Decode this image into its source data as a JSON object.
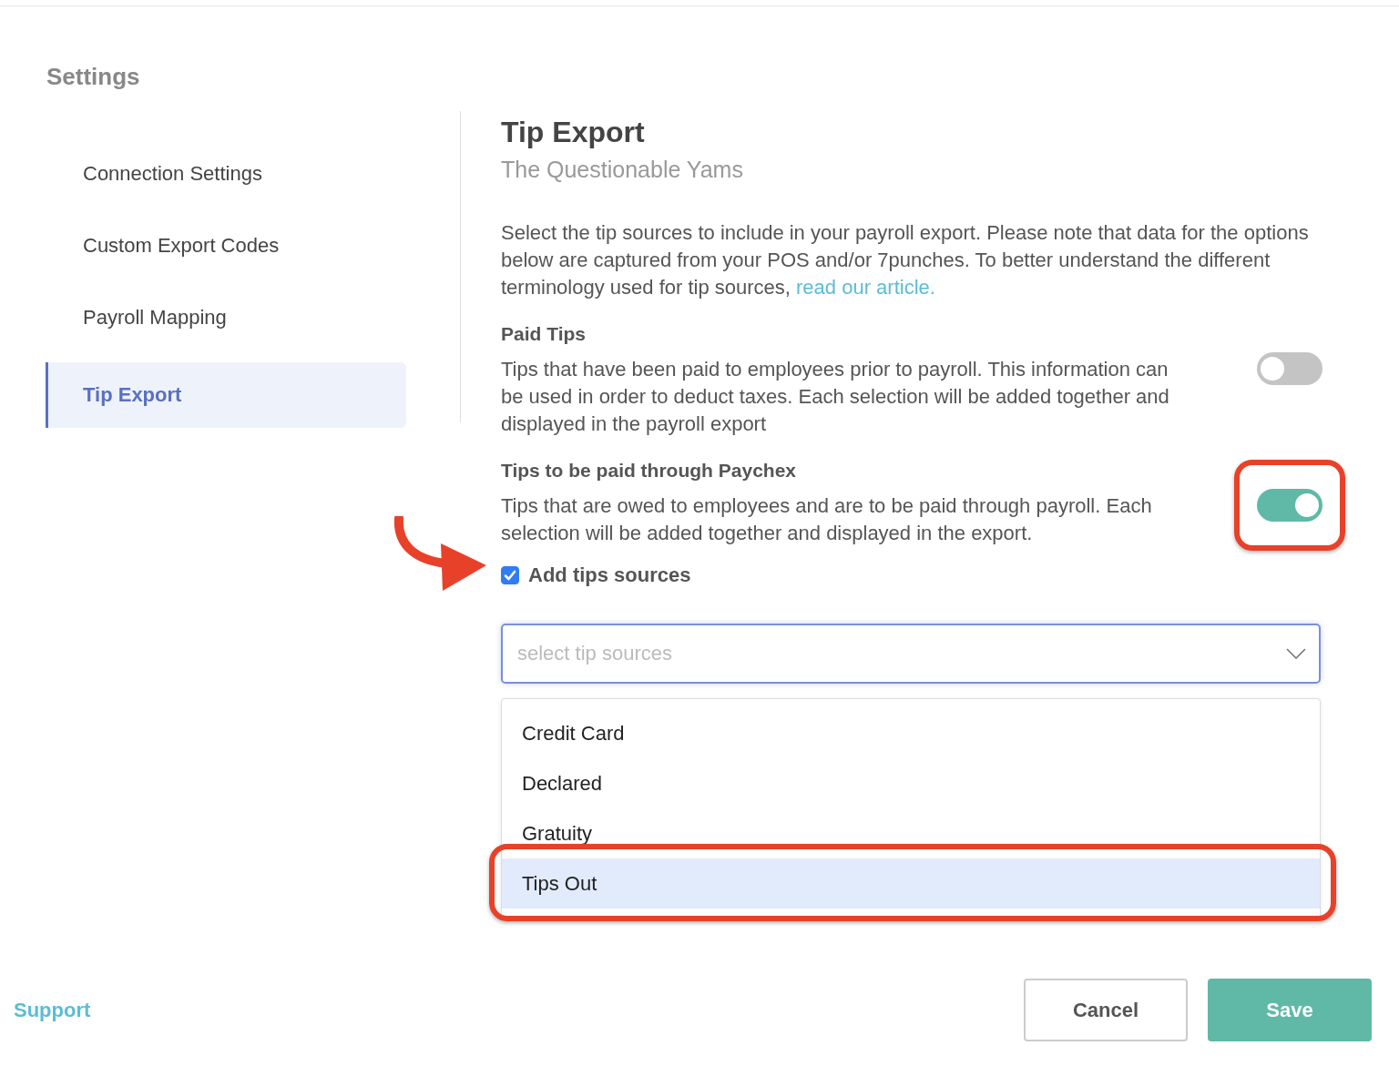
{
  "sidebar": {
    "title": "Settings",
    "items": [
      {
        "label": "Connection Settings",
        "selected": false
      },
      {
        "label": "Custom Export Codes",
        "selected": false
      },
      {
        "label": "Payroll Mapping",
        "selected": false
      },
      {
        "label": "Tip Export",
        "selected": true
      }
    ]
  },
  "content": {
    "title": "Tip Export",
    "subtitle": "The Questionable Yams",
    "description": "Select the tip sources to include in your payroll export. Please note that data for the options below are captured from your POS and/or 7punches. To better understand the different terminology used for tip sources,",
    "description_link": "read our article.",
    "sections": [
      {
        "title": "Paid Tips",
        "description": "Tips that have been paid to employees prior to payroll. This information can be used in order to deduct taxes. Each selection will be added together and displayed in the payroll export",
        "on": false,
        "highlighted": false
      },
      {
        "title": "Tips to be paid through Paychex",
        "description": "Tips that are owed to employees and are to be paid through payroll. Each selection will be added together and displayed in the export.",
        "on": true,
        "highlighted": true
      }
    ],
    "checkbox": {
      "label": "Add tips sources",
      "checked": true,
      "pointed": true
    },
    "select": {
      "placeholder": "select tip sources",
      "options": [
        {
          "label": "Credit Card",
          "selected": false,
          "highlighted": false
        },
        {
          "label": "Declared",
          "selected": false,
          "highlighted": false
        },
        {
          "label": "Gratuity",
          "selected": false,
          "highlighted": false
        },
        {
          "label": "Tips Out",
          "selected": true,
          "highlighted": true
        }
      ]
    }
  },
  "footer": {
    "support_link": "Support",
    "buttons": [
      {
        "label": "Cancel",
        "kind": "secondary"
      },
      {
        "label": "Save",
        "kind": "primary"
      }
    ]
  }
}
